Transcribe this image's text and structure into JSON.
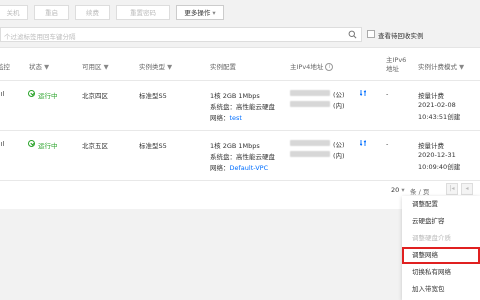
{
  "toolbar": {
    "buttons": [
      "关机",
      "重启",
      "续费",
      "重置密码"
    ],
    "more_label": "更多操作",
    "more_caret": "▾"
  },
  "search": {
    "placeholder": "个过滤标签用回车键分隔",
    "checkbox_label": "查看待回收实例"
  },
  "table": {
    "headers": {
      "monitor": "监控",
      "status": "状态",
      "zone": "可用区",
      "type": "实例类型",
      "config": "实例配置",
      "ipv4": "主IPv4地址",
      "ipv6_line1": "主IPv6",
      "ipv6_line2": "地址",
      "billing": "实例计费模式"
    },
    "rows": [
      {
        "status": "运行中",
        "zone": "北京四区",
        "type": "标准型S5",
        "config_line1": "1核 2GB 1Mbps",
        "config_line2": "系统盘：高性能云硬盘",
        "network_label": "网络：",
        "network_value": "test",
        "ip_public_suffix": "(公)",
        "ip_private_suffix": "(内)",
        "ipv6": "-",
        "billing": "按量计费",
        "date": "2021-02-08",
        "time": "10:43:51创建"
      },
      {
        "status": "运行中",
        "zone": "北京五区",
        "type": "标准型S5",
        "config_line1": "1核 2GB 1Mbps",
        "config_line2": "系统盘：高性能云硬盘",
        "network_label": "网络：",
        "network_value": "Default-VPC",
        "ip_public_suffix": "(公)",
        "ip_private_suffix": "(内)",
        "ipv6": "-",
        "billing": "按量计费",
        "date": "2020-12-31",
        "time": "10:09:40创建"
      }
    ]
  },
  "pagination": {
    "page_size": "20",
    "caret": "▾",
    "per_page": "条 / 页",
    "first": "|◂",
    "prev": "◂"
  },
  "menu": {
    "items": [
      {
        "label": "调整配置",
        "disabled": false
      },
      {
        "label": "云硬盘扩容",
        "disabled": false
      },
      {
        "label": "调整硬盘介质",
        "disabled": true
      },
      {
        "label": "调整网络",
        "disabled": false,
        "highlighted": true
      },
      {
        "label": "切换私有网络",
        "disabled": false
      },
      {
        "label": "加入带宽包",
        "disabled": false
      }
    ]
  },
  "colors": {
    "accent": "#006eff",
    "running": "#29a329",
    "highlight_border": "#e02020"
  }
}
